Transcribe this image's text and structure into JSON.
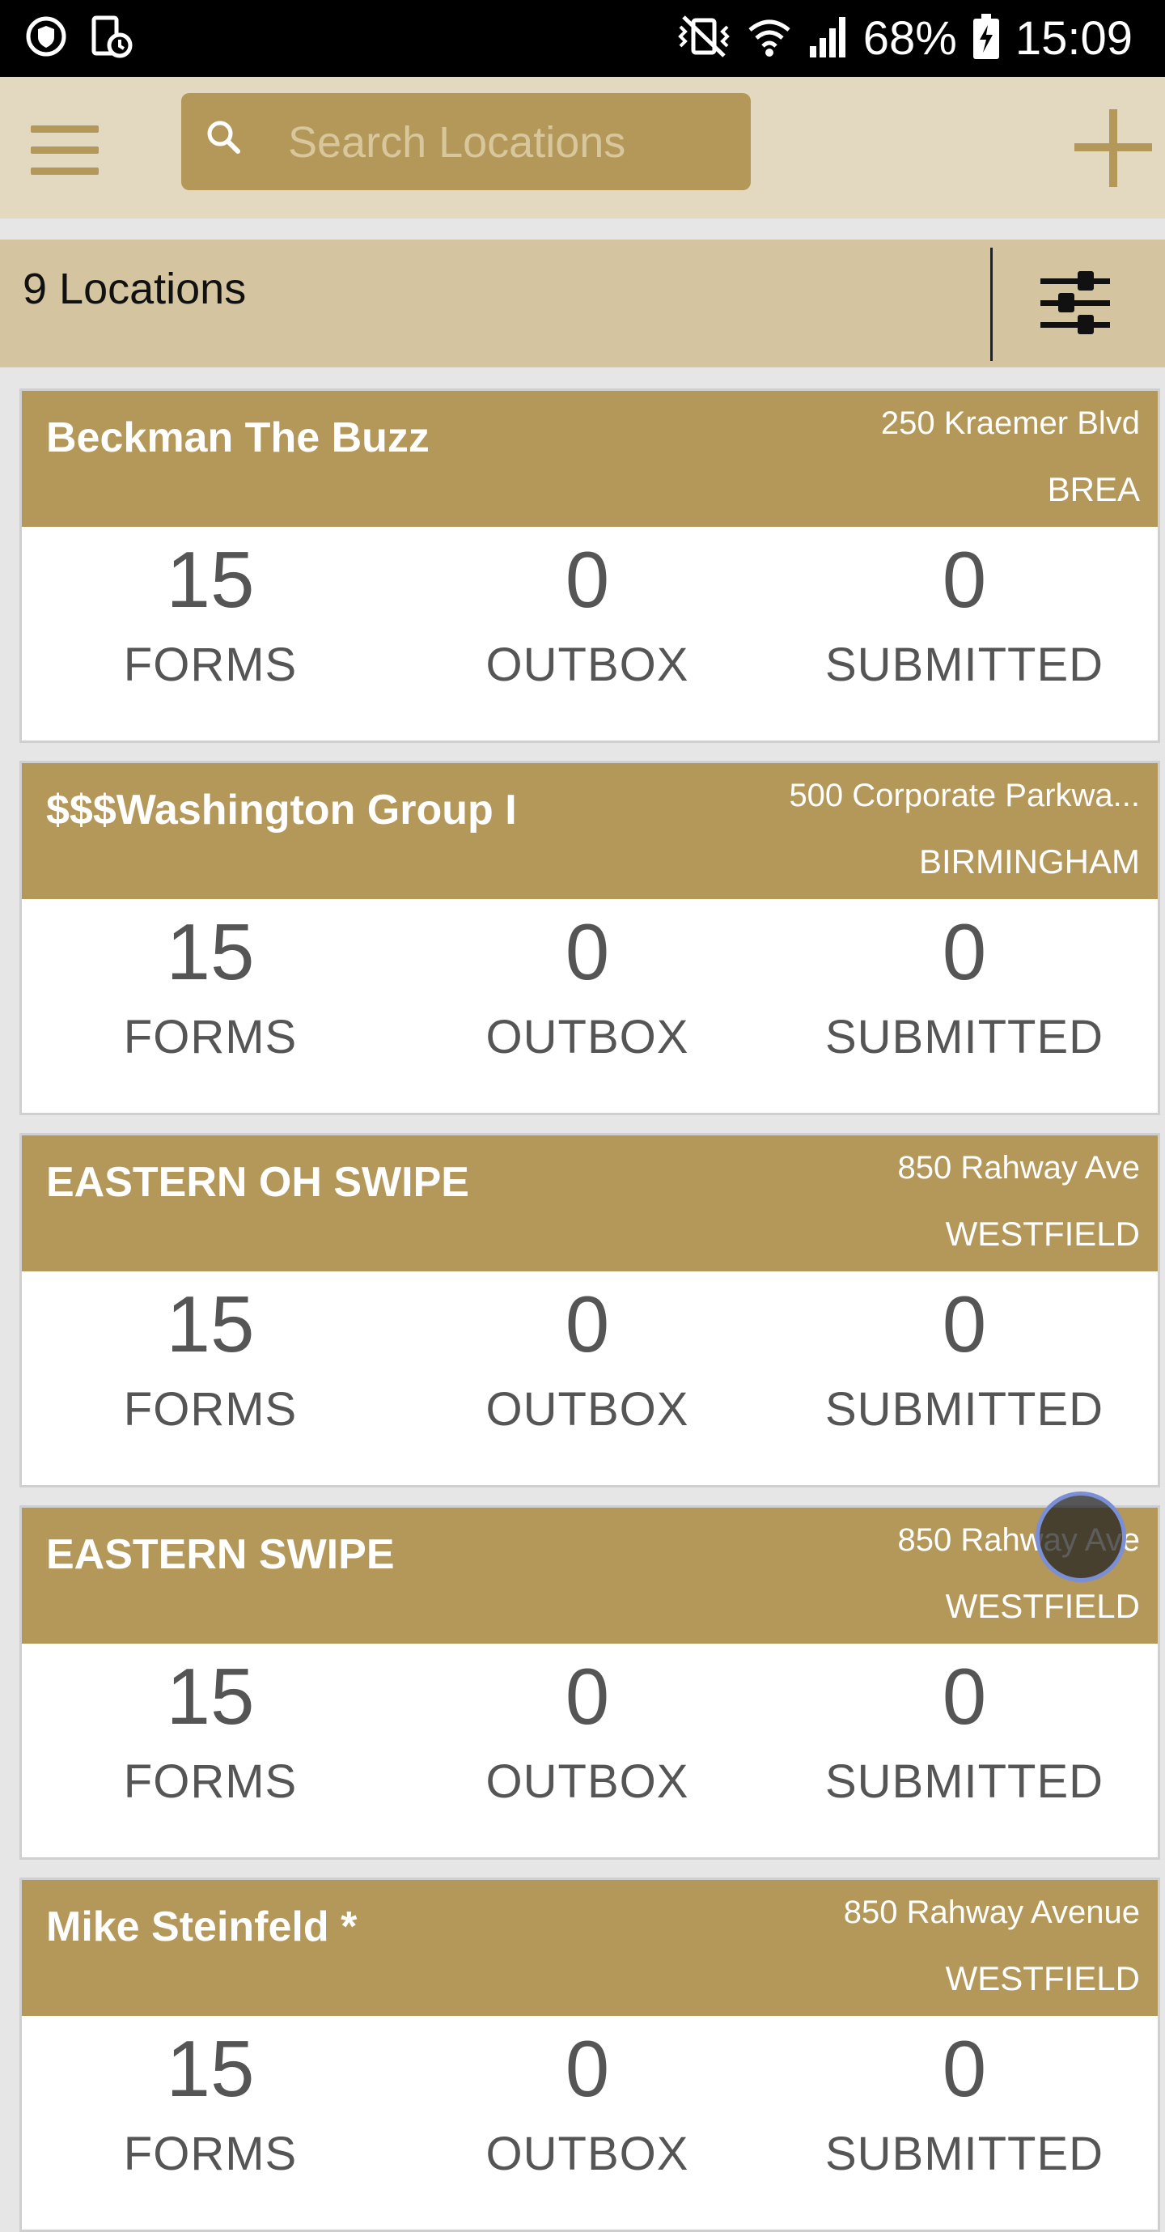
{
  "status_bar": {
    "battery": "68%",
    "time": "15:09",
    "icons": [
      "shield-icon",
      "document-clock-icon",
      "vibrate-mute-icon",
      "wifi-icon",
      "signal-icon",
      "battery-icon"
    ]
  },
  "app_bar": {
    "menu_icon": "hamburger-icon",
    "search_placeholder": "Search Locations",
    "add_icon": "plus-icon"
  },
  "summary": {
    "count_label": "9 Locations",
    "filter_icon": "sliders-icon"
  },
  "locations": [
    {
      "name": "Beckman The Buzz",
      "address": "250 Kraemer Blvd",
      "city": "BREA",
      "forms": "15",
      "outbox": "0",
      "submitted": "0"
    },
    {
      "name": "$$$Washington Group I",
      "address": "500 Corporate Parkwa...",
      "city": "BIRMINGHAM",
      "forms": "15",
      "outbox": "0",
      "submitted": "0"
    },
    {
      "name": "EASTERN OH SWIPE",
      "address": "850 Rahway Ave",
      "city": "WESTFIELD",
      "forms": "15",
      "outbox": "0",
      "submitted": "0"
    },
    {
      "name": "EASTERN SWIPE",
      "address": "850 Rahway Ave",
      "city": "WESTFIELD",
      "forms": "15",
      "outbox": "0",
      "submitted": "0"
    },
    {
      "name": "Mike Steinfeld *",
      "address": "850 Rahway Avenue",
      "city": "WESTFIELD",
      "forms": "15",
      "outbox": "0",
      "submitted": "0"
    }
  ],
  "labels": {
    "forms": "FORMS",
    "outbox": "OUTBOX",
    "submitted": "SUBMITTED"
  },
  "colors": {
    "accent": "#b3985a",
    "app_bar": "#e3d9c0",
    "summary_bar": "#d4c5a0",
    "background": "#e6e6e6"
  }
}
